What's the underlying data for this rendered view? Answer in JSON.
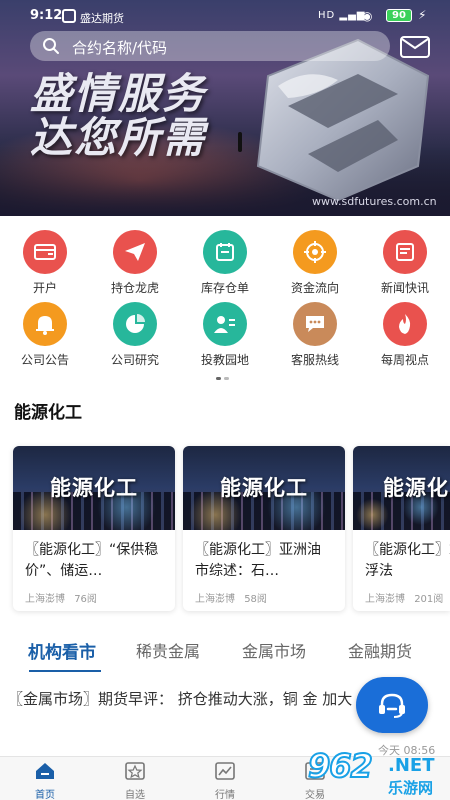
{
  "status_bar": {
    "time": "9:12",
    "app_name": "盛达期货",
    "signal": "HD",
    "battery": "90"
  },
  "search": {
    "placeholder": "合约名称/代码"
  },
  "banner": {
    "slogan_line1": "盛情服务",
    "slogan_line2": "达您所需",
    "url": "www.sdfutures.com.cn"
  },
  "grid": {
    "items": [
      {
        "label": "开户",
        "icon": "card-icon",
        "color": "#e9524e"
      },
      {
        "label": "持仓龙虎",
        "icon": "send-icon",
        "color": "#e9524e"
      },
      {
        "label": "库存仓单",
        "icon": "calendar-icon",
        "color": "#27b79b"
      },
      {
        "label": "资金流向",
        "icon": "target-icon",
        "color": "#f49a1f"
      },
      {
        "label": "新闻快讯",
        "icon": "news-icon",
        "color": "#e9524e"
      },
      {
        "label": "公司公告",
        "icon": "bell-icon",
        "color": "#f49a1f"
      },
      {
        "label": "公司研究",
        "icon": "pie-icon",
        "color": "#27b79b"
      },
      {
        "label": "投教园地",
        "icon": "person-icon",
        "color": "#27b79b"
      },
      {
        "label": "客服热线",
        "icon": "chat-icon",
        "color": "#c98a5a"
      },
      {
        "label": "每周视点",
        "icon": "fire-icon",
        "color": "#e9524e"
      }
    ]
  },
  "section": {
    "title": "能源化工"
  },
  "cards": [
    {
      "img_title": "能源化工",
      "text": "〖能源化工〗“保供稳价”、储运…",
      "source": "上海澎博",
      "reads": "76阅"
    },
    {
      "img_title": "能源化工",
      "text": "〖能源化工〗亚洲油市综述：石…",
      "source": "上海澎博",
      "reads": "58阅"
    },
    {
      "img_title": "能源化",
      "text": "〖能源化工〗末国内浮法",
      "source": "上海澎博",
      "reads": "201阅"
    }
  ],
  "tabs": [
    {
      "label": "机构看市",
      "active": true
    },
    {
      "label": "稀贵金属",
      "active": false
    },
    {
      "label": "金属市场",
      "active": false
    },
    {
      "label": "金融期货",
      "active": false
    }
  ],
  "news": {
    "text": "〖金属市场〗期货早评： 挤仓推动大涨，铜 金 加大",
    "time": "今天 08:56"
  },
  "bottom_nav": [
    {
      "label": "首页",
      "icon": "home-icon",
      "active": true
    },
    {
      "label": "自选",
      "icon": "star-icon",
      "active": false
    },
    {
      "label": "行情",
      "icon": "chart-icon",
      "active": false
    },
    {
      "label": "交易",
      "icon": "trade-icon",
      "active": false
    }
  ],
  "watermark": {
    "brand": "962",
    "suffix": ".NET",
    "site": "乐游网"
  },
  "colors": {
    "accent": "#1a5fa8",
    "support_button": "#1a6ed8"
  }
}
